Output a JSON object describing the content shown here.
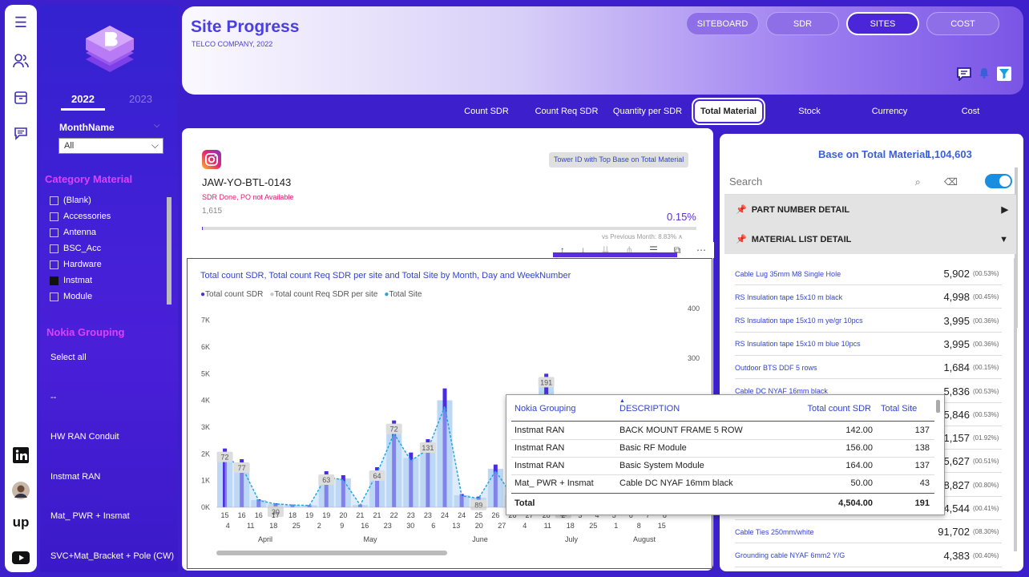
{
  "header": {
    "title": "Site Progress",
    "subtitle": "TELCO COMPANY, 2022",
    "nav": [
      "SITEBOARD",
      "SDR",
      "SITES",
      "COST"
    ],
    "active_nav": "SITES"
  },
  "subtabs": [
    "Count SDR",
    "Count Req SDR",
    "Quantity per SDR",
    "Total Material",
    "Stock",
    "Currency",
    "Cost"
  ],
  "active_subtab": "Total Material",
  "filters": {
    "years": [
      "2022",
      "2023"
    ],
    "month_label": "MonthName",
    "month_value": "All",
    "category_title": "Category Material",
    "category_items": [
      {
        "label": "(Blank)",
        "checked": false
      },
      {
        "label": "Accessories",
        "checked": false
      },
      {
        "label": "Antenna",
        "checked": false
      },
      {
        "label": "BSC_Acc",
        "checked": false
      },
      {
        "label": "Hardware",
        "checked": false
      },
      {
        "label": "Instmat",
        "checked": true
      },
      {
        "label": "Module",
        "checked": false
      }
    ],
    "nokia_title": "Nokia Grouping",
    "nokia_items": [
      "Select all",
      "--",
      "HW RAN Conduit",
      "Instmat RAN",
      "Mat_ PWR + Insmat",
      "SVC+Mat_Bracket + Pole (CW)"
    ]
  },
  "kpi": {
    "badge": "Tower ID with Top Base on Total Material",
    "site_id": "JAW-YO-BTL-0143",
    "status": "SDR Done, PO not Available",
    "value": "1,615",
    "percent": "0.15%",
    "progress": 0.0015,
    "vs_text": "vs Previous Month: 8.83% ∧"
  },
  "chart_data": {
    "type": "bar",
    "title": "Total count SDR, Total count Req SDR per site and Total Site by Month, Day and WeekNumber",
    "legend": [
      "Total count SDR",
      "Total count Req SDR per site",
      "Total Site"
    ],
    "colors": {
      "sdr": "#4a2de0",
      "req": "#c8c8c8",
      "site": "#1fa8e0",
      "sdr_light": "#bcd8f5"
    },
    "ylim": [
      0,
      7500
    ],
    "y2lim": [
      0,
      450
    ],
    "yticks": [
      "0K",
      "1K",
      "2K",
      "3K",
      "4K",
      "5K",
      "6K",
      "7K"
    ],
    "y2ticks": [
      "300",
      "400"
    ],
    "days": [
      "15",
      "16",
      "16",
      "17",
      "18",
      "19",
      "19",
      "20",
      "21",
      "21",
      "22",
      "23",
      "23",
      "24",
      "24",
      "25",
      "26",
      "26",
      "27",
      "28",
      "2",
      "3",
      "4",
      "5",
      "6",
      "7",
      "8"
    ],
    "weeks": [
      "4",
      "11",
      "18",
      "25",
      "2",
      "9",
      "16",
      "23",
      "30",
      "6",
      "13",
      "20",
      "27",
      "4",
      "11",
      "18",
      "25",
      "1",
      "8",
      "15"
    ],
    "months": [
      "April",
      "May",
      "June",
      "July",
      "August"
    ],
    "values": [
      2200,
      1800,
      300,
      150,
      100,
      80,
      1350,
      1200,
      100,
      1500,
      3250,
      2050,
      2550,
      4450,
      500,
      400,
      1600,
      500,
      1100,
      5000,
      100,
      200,
      800,
      1000,
      900,
      600,
      300
    ],
    "data_labels": [
      "72",
      "77",
      "30",
      "63",
      "64",
      "72",
      "131",
      "89",
      "125",
      "191",
      "11",
      "307"
    ]
  },
  "right": {
    "title": "Base on Total Material",
    "total": "1,104,603",
    "search_placeholder": "Search",
    "sections": [
      "PART NUMBER DETAIL",
      "MATERIAL LIST DETAIL"
    ],
    "materials": [
      {
        "name": "Cable Lug 35mm M8 Single Hole",
        "value": "5,902",
        "pct": "(00.53%)"
      },
      {
        "name": "RS Insulation tape 15x10 m black",
        "value": "4,998",
        "pct": "(00.45%)"
      },
      {
        "name": "RS Insulation tape 15x10 m ye/gr 10pcs",
        "value": "3,995",
        "pct": "(00.36%)"
      },
      {
        "name": "RS Insulation tape 15x10 m blue 10pcs",
        "value": "3,995",
        "pct": "(00.36%)"
      },
      {
        "name": "Outdoor BTS DDF 5 rows",
        "value": "1,684",
        "pct": "(00.15%)"
      },
      {
        "name": "Cable DC NYAF 16mm black",
        "value": "5,836",
        "pct": "(00.53%)"
      },
      {
        "name": "",
        "value": "5,846",
        "pct": "(00.53%)"
      },
      {
        "name": "",
        "value": "21,157",
        "pct": "(01.92%)"
      },
      {
        "name": "",
        "value": "5,627",
        "pct": "(00.51%)"
      },
      {
        "name": "",
        "value": "8,827",
        "pct": "(00.80%)"
      },
      {
        "name": "",
        "value": "4,544",
        "pct": "(00.41%)"
      },
      {
        "name": "Cable Ties 250mm/white",
        "value": "91,702",
        "pct": "(08.30%)"
      },
      {
        "name": "Grounding cable NYAF 6mm2 Y/G",
        "value": "4,383",
        "pct": "(00.40%)"
      }
    ]
  },
  "tooltip": {
    "headers": [
      "Nokia Grouping",
      "DESCRIPTION",
      "Total count SDR",
      "Total Site"
    ],
    "rows": [
      [
        "Instmat RAN",
        "BACK MOUNT FRAME 5 ROW",
        "142.00",
        "137"
      ],
      [
        "Instmat RAN",
        "Basic RF Module",
        "156.00",
        "138"
      ],
      [
        "Instmat RAN",
        "Basic System Module",
        "164.00",
        "137"
      ],
      [
        "Mat_ PWR + Insmat",
        "Cable DC NYAF 16mm black",
        "50.00",
        "43"
      ]
    ],
    "total": [
      "Total",
      "4,504.00",
      "191"
    ]
  }
}
